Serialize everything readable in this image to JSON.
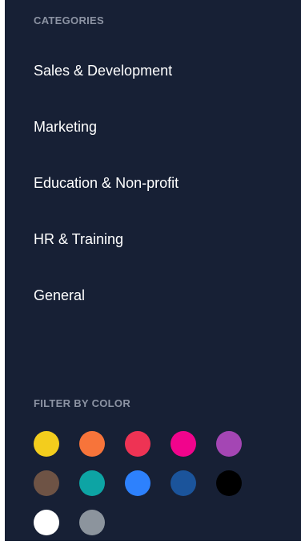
{
  "categories_heading": "CATEGORIES",
  "categories": [
    {
      "label": "Sales & Development"
    },
    {
      "label": "Marketing"
    },
    {
      "label": "Education & Non-profit"
    },
    {
      "label": "HR & Training"
    },
    {
      "label": "General"
    }
  ],
  "filter_heading": "FILTER BY COLOR",
  "colors": {
    "panel_background": "#172035",
    "heading_text": "#8c93a3",
    "item_text": "#ffffff"
  },
  "swatches": [
    [
      {
        "name": "yellow",
        "hex": "#f3cd1d"
      },
      {
        "name": "orange",
        "hex": "#f7743a"
      },
      {
        "name": "red",
        "hex": "#ee3354"
      },
      {
        "name": "pink",
        "hex": "#f1048c"
      },
      {
        "name": "purple",
        "hex": "#a446b4"
      }
    ],
    [
      {
        "name": "brown",
        "hex": "#6e5345"
      },
      {
        "name": "teal",
        "hex": "#0da4a4"
      },
      {
        "name": "blue",
        "hex": "#2d81fd"
      },
      {
        "name": "navy",
        "hex": "#1b549b"
      },
      {
        "name": "black",
        "hex": "#000000"
      }
    ],
    [
      {
        "name": "white",
        "hex": "#ffffff"
      },
      {
        "name": "gray",
        "hex": "#8c949d"
      }
    ]
  ]
}
